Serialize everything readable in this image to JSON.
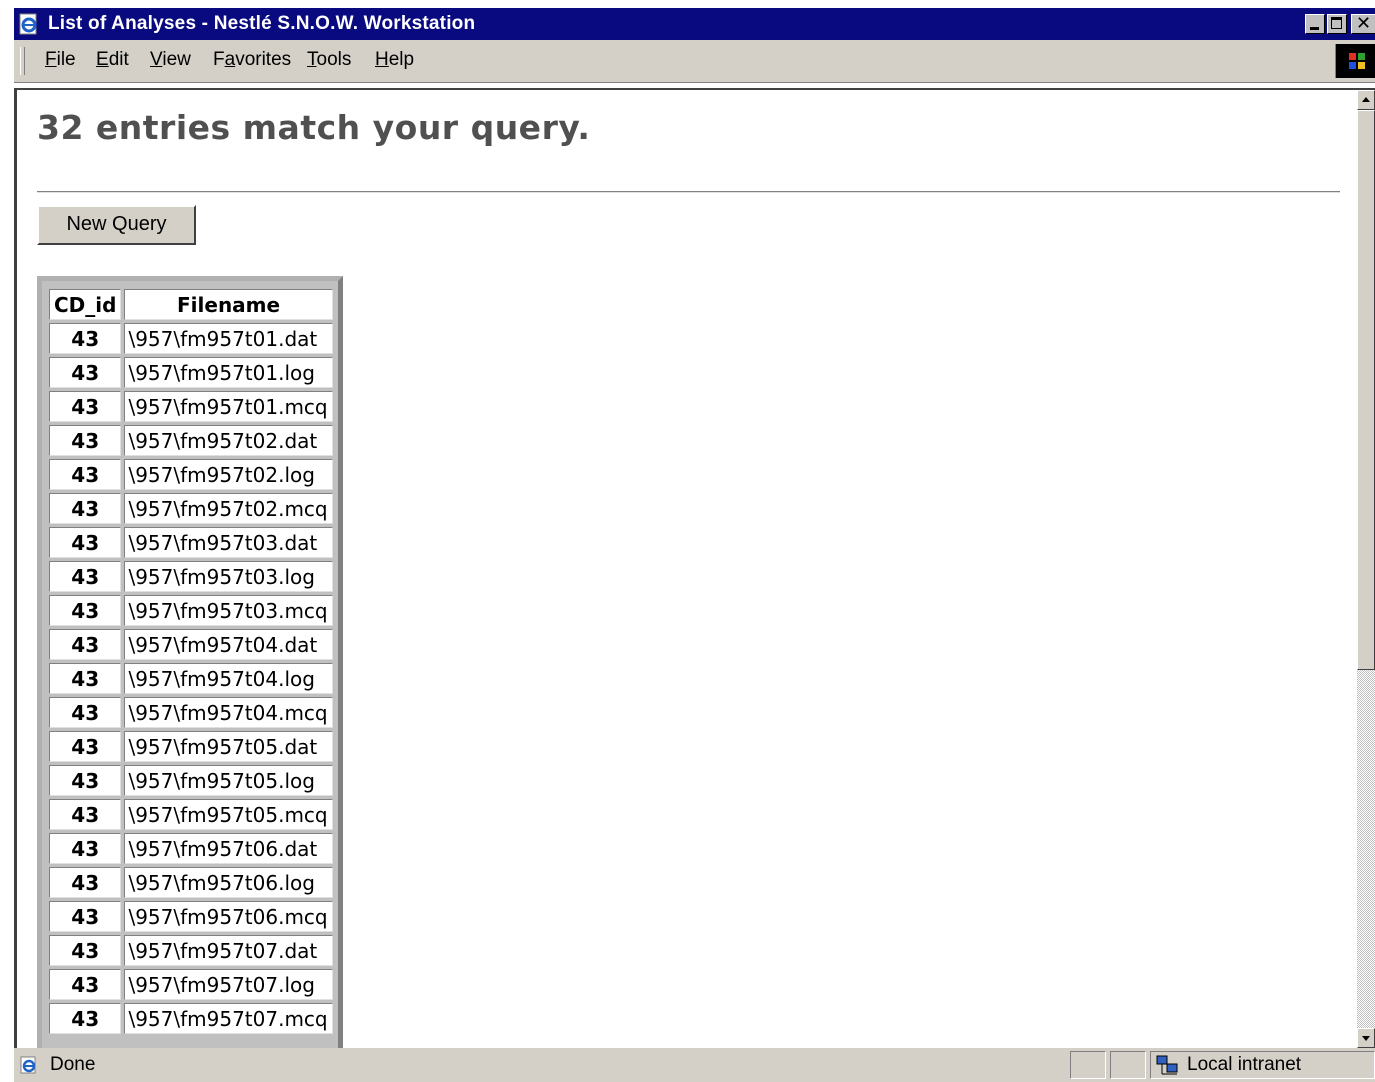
{
  "window": {
    "title": "List of Analyses - Nestlé S.N.O.W. Workstation"
  },
  "menu": {
    "items": [
      {
        "label": "File",
        "accel": "F",
        "rest": "ile"
      },
      {
        "label": "Edit",
        "accel": "E",
        "rest": "dit"
      },
      {
        "label": "View",
        "accel": "V",
        "rest": "iew"
      },
      {
        "label": "Favorites",
        "pre": "F",
        "accel": "a",
        "rest": "vorites"
      },
      {
        "label": "Tools",
        "accel": "T",
        "rest": "ools"
      },
      {
        "label": "Help",
        "accel": "H",
        "rest": "elp"
      }
    ]
  },
  "page": {
    "heading": "32 entries match your query.",
    "new_query_label": "New Query"
  },
  "table": {
    "headers": [
      "CD_id",
      "Filename"
    ],
    "rows": [
      {
        "cd_id": "43",
        "filename": "\\957\\fm957t01.dat"
      },
      {
        "cd_id": "43",
        "filename": "\\957\\fm957t01.log"
      },
      {
        "cd_id": "43",
        "filename": "\\957\\fm957t01.mcq"
      },
      {
        "cd_id": "43",
        "filename": "\\957\\fm957t02.dat"
      },
      {
        "cd_id": "43",
        "filename": "\\957\\fm957t02.log"
      },
      {
        "cd_id": "43",
        "filename": "\\957\\fm957t02.mcq"
      },
      {
        "cd_id": "43",
        "filename": "\\957\\fm957t03.dat"
      },
      {
        "cd_id": "43",
        "filename": "\\957\\fm957t03.log"
      },
      {
        "cd_id": "43",
        "filename": "\\957\\fm957t03.mcq"
      },
      {
        "cd_id": "43",
        "filename": "\\957\\fm957t04.dat"
      },
      {
        "cd_id": "43",
        "filename": "\\957\\fm957t04.log"
      },
      {
        "cd_id": "43",
        "filename": "\\957\\fm957t04.mcq"
      },
      {
        "cd_id": "43",
        "filename": "\\957\\fm957t05.dat"
      },
      {
        "cd_id": "43",
        "filename": "\\957\\fm957t05.log"
      },
      {
        "cd_id": "43",
        "filename": "\\957\\fm957t05.mcq"
      },
      {
        "cd_id": "43",
        "filename": "\\957\\fm957t06.dat"
      },
      {
        "cd_id": "43",
        "filename": "\\957\\fm957t06.log"
      },
      {
        "cd_id": "43",
        "filename": "\\957\\fm957t06.mcq"
      },
      {
        "cd_id": "43",
        "filename": "\\957\\fm957t07.dat"
      },
      {
        "cd_id": "43",
        "filename": "\\957\\fm957t07.log"
      },
      {
        "cd_id": "43",
        "filename": "\\957\\fm957t07.mcq"
      }
    ]
  },
  "statusbar": {
    "status": "Done",
    "zone": "Local intranet"
  },
  "icons": {
    "app": "ie-page-icon",
    "throbber": "windows-logo-icon",
    "status": "ie-page-icon",
    "zone": "local-intranet-icon"
  },
  "colors": {
    "titlebar": "#0a0a80",
    "chrome": "#d4d0c8",
    "heading": "#505050"
  }
}
